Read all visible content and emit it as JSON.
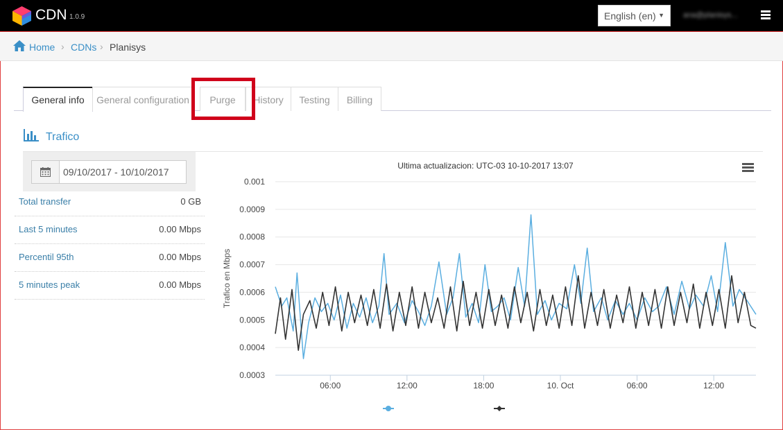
{
  "app": {
    "title": "CDN",
    "version": "1.0.9"
  },
  "header": {
    "language": "English (en)",
    "user": "ana@planisys..."
  },
  "breadcrumb": [
    {
      "label": "Home",
      "link": true
    },
    {
      "label": "CDNs",
      "link": true
    },
    {
      "label": "Planisys",
      "link": false
    }
  ],
  "tabs": [
    {
      "label": "General info",
      "active": true
    },
    {
      "label": "General configuration",
      "active": false
    },
    {
      "label": "Purge",
      "active": false,
      "highlighted": true
    },
    {
      "label": "History",
      "active": false
    },
    {
      "label": "Testing",
      "active": false
    },
    {
      "label": "Billing",
      "active": false
    }
  ],
  "section": {
    "title": "Trafico",
    "icon": "bar-chart-icon"
  },
  "date_range": "09/10/2017 - 10/10/2017",
  "stats": [
    {
      "label": "Total transfer",
      "value": "0 GB"
    },
    {
      "label": "Last 5 minutes",
      "value": "0.00 Mbps"
    },
    {
      "label": "Percentil 95th",
      "value": "0.00 Mbps"
    },
    {
      "label": "5 minutes peak",
      "value": "0.00 Mbps"
    }
  ],
  "colors": {
    "accent": "#3a8fc7",
    "series_blue": "#5aaee0",
    "series_dark": "#333333",
    "highlight": "#d0021b"
  },
  "chart_data": {
    "type": "line",
    "title": "Ultima actualizacion: UTC-03 10-10-2017 13:07",
    "ylabel": "Trafico en Mbps",
    "xlabel": "",
    "ylim": [
      0.0003,
      0.001
    ],
    "yticks": [
      "0.001",
      "0.0009",
      "0.0008",
      "0.0007",
      "0.0006",
      "0.0005",
      "0.0004",
      "0.0003"
    ],
    "xticks": [
      {
        "label": "06:00",
        "hours": 6
      },
      {
        "label": "12:00",
        "hours": 12
      },
      {
        "label": "18:00",
        "hours": 18
      },
      {
        "label": "10. Oct",
        "hours": 24
      },
      {
        "label": "06:00",
        "hours": 30
      },
      {
        "label": "12:00",
        "hours": 36
      }
    ],
    "xlim_hours": [
      1.7,
      39.3
    ],
    "series": [
      {
        "name": "",
        "color": "#5aaee0",
        "points": [
          [
            1.7,
            0.00062
          ],
          [
            2.2,
            0.00055
          ],
          [
            2.6,
            0.00058
          ],
          [
            3.1,
            0.00046
          ],
          [
            3.4,
            0.00067
          ],
          [
            3.9,
            0.00036
          ],
          [
            4.3,
            0.00049
          ],
          [
            4.8,
            0.00058
          ],
          [
            5.3,
            0.00053
          ],
          [
            5.8,
            0.00056
          ],
          [
            6.3,
            0.0005
          ],
          [
            6.8,
            0.00059
          ],
          [
            7.3,
            0.00047
          ],
          [
            7.8,
            0.00056
          ],
          [
            8.3,
            0.00051
          ],
          [
            8.8,
            0.00058
          ],
          [
            9.3,
            0.00049
          ],
          [
            9.8,
            0.00055
          ],
          [
            10.2,
            0.00074
          ],
          [
            10.6,
            0.00052
          ],
          [
            11.2,
            0.00056
          ],
          [
            11.8,
            0.00049
          ],
          [
            12.4,
            0.00057
          ],
          [
            12.9,
            0.00053
          ],
          [
            13.4,
            0.00048
          ],
          [
            13.9,
            0.00055
          ],
          [
            14.5,
            0.00071
          ],
          [
            15.1,
            0.00052
          ],
          [
            15.6,
            0.00058
          ],
          [
            16.1,
            0.00074
          ],
          [
            16.6,
            0.00051
          ],
          [
            17.1,
            0.00056
          ],
          [
            17.6,
            0.00049
          ],
          [
            18.1,
            0.0007
          ],
          [
            18.6,
            0.00053
          ],
          [
            19.1,
            0.00055
          ],
          [
            19.6,
            0.00058
          ],
          [
            20.1,
            0.0005
          ],
          [
            20.7,
            0.00069
          ],
          [
            21.2,
            0.00055
          ],
          [
            21.7,
            0.00088
          ],
          [
            22.2,
            0.00052
          ],
          [
            22.8,
            0.00057
          ],
          [
            23.3,
            0.0005
          ],
          [
            23.9,
            0.00056
          ],
          [
            24.5,
            0.00054
          ],
          [
            25.1,
            0.0007
          ],
          [
            25.6,
            0.00056
          ],
          [
            26.1,
            0.00076
          ],
          [
            26.6,
            0.00053
          ],
          [
            27.2,
            0.00058
          ],
          [
            27.7,
            0.0005
          ],
          [
            28.3,
            0.00057
          ],
          [
            28.9,
            0.00052
          ],
          [
            29.4,
            0.00056
          ],
          [
            30.0,
            0.0005
          ],
          [
            30.6,
            0.00058
          ],
          [
            31.2,
            0.00053
          ],
          [
            31.7,
            0.00055
          ],
          [
            32.3,
            0.00062
          ],
          [
            32.9,
            0.00052
          ],
          [
            33.5,
            0.00064
          ],
          [
            34.1,
            0.00054
          ],
          [
            34.6,
            0.00059
          ],
          [
            35.2,
            0.00055
          ],
          [
            35.8,
            0.00066
          ],
          [
            36.3,
            0.00053
          ],
          [
            36.9,
            0.00078
          ],
          [
            37.5,
            0.00055
          ],
          [
            38.0,
            0.00061
          ],
          [
            38.6,
            0.00057
          ],
          [
            39.3,
            0.00052
          ]
        ]
      },
      {
        "name": "",
        "color": "#333333",
        "points": [
          [
            1.7,
            0.00045
          ],
          [
            2.1,
            0.00058
          ],
          [
            2.5,
            0.00043
          ],
          [
            3.0,
            0.00061
          ],
          [
            3.5,
            0.00039
          ],
          [
            3.9,
            0.00052
          ],
          [
            4.4,
            0.00057
          ],
          [
            4.9,
            0.00047
          ],
          [
            5.4,
            0.0006
          ],
          [
            5.9,
            0.00048
          ],
          [
            6.4,
            0.00062
          ],
          [
            6.9,
            0.00046
          ],
          [
            7.4,
            0.0006
          ],
          [
            7.9,
            0.00049
          ],
          [
            8.4,
            0.00059
          ],
          [
            8.9,
            0.00048
          ],
          [
            9.4,
            0.00061
          ],
          [
            9.9,
            0.00047
          ],
          [
            10.4,
            0.00063
          ],
          [
            10.9,
            0.00046
          ],
          [
            11.4,
            0.0006
          ],
          [
            11.9,
            0.00048
          ],
          [
            12.4,
            0.00062
          ],
          [
            12.9,
            0.00047
          ],
          [
            13.4,
            0.0006
          ],
          [
            13.9,
            0.00049
          ],
          [
            14.4,
            0.00058
          ],
          [
            14.9,
            0.00047
          ],
          [
            15.4,
            0.00062
          ],
          [
            15.9,
            0.00046
          ],
          [
            16.4,
            0.00064
          ],
          [
            16.9,
            0.00048
          ],
          [
            17.4,
            0.0006
          ],
          [
            17.9,
            0.00047
          ],
          [
            18.4,
            0.00061
          ],
          [
            18.9,
            0.00048
          ],
          [
            19.4,
            0.00059
          ],
          [
            19.9,
            0.00047
          ],
          [
            20.4,
            0.00062
          ],
          [
            20.9,
            0.00049
          ],
          [
            21.4,
            0.0006
          ],
          [
            21.9,
            0.00046
          ],
          [
            22.4,
            0.00061
          ],
          [
            22.9,
            0.00048
          ],
          [
            23.4,
            0.00059
          ],
          [
            23.9,
            0.00047
          ],
          [
            24.4,
            0.00062
          ],
          [
            24.9,
            0.00048
          ],
          [
            25.4,
            0.00066
          ],
          [
            25.9,
            0.00047
          ],
          [
            26.4,
            0.0006
          ],
          [
            26.9,
            0.00048
          ],
          [
            27.4,
            0.00061
          ],
          [
            27.9,
            0.00047
          ],
          [
            28.4,
            0.00059
          ],
          [
            28.9,
            0.00049
          ],
          [
            29.4,
            0.00062
          ],
          [
            29.9,
            0.00047
          ],
          [
            30.4,
            0.0006
          ],
          [
            30.9,
            0.00048
          ],
          [
            31.4,
            0.00061
          ],
          [
            31.9,
            0.00047
          ],
          [
            32.4,
            0.00062
          ],
          [
            32.9,
            0.00048
          ],
          [
            33.4,
            0.0006
          ],
          [
            33.9,
            0.00049
          ],
          [
            34.4,
            0.00063
          ],
          [
            34.9,
            0.00047
          ],
          [
            35.4,
            0.0006
          ],
          [
            35.9,
            0.00048
          ],
          [
            36.4,
            0.00061
          ],
          [
            36.9,
            0.00047
          ],
          [
            37.4,
            0.00066
          ],
          [
            37.9,
            0.00049
          ],
          [
            38.4,
            0.0006
          ],
          [
            38.9,
            0.00048
          ],
          [
            39.3,
            0.00047
          ]
        ]
      }
    ]
  }
}
